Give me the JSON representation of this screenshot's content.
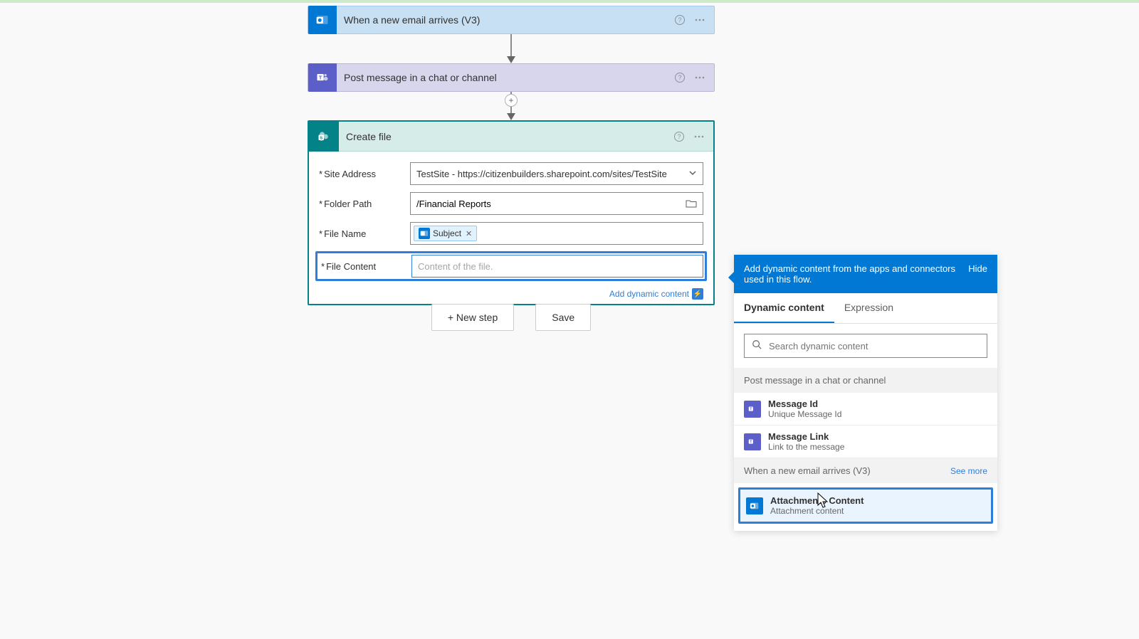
{
  "cards": {
    "trigger": {
      "title": "When a new email arrives (V3)"
    },
    "teams": {
      "title": "Post message in a chat or channel"
    },
    "createfile": {
      "title": "Create file"
    }
  },
  "form": {
    "siteAddress": {
      "label": "Site Address",
      "value": "TestSite - https://citizenbuilders.sharepoint.com/sites/TestSite"
    },
    "folderPath": {
      "label": "Folder Path",
      "value": "/Financial Reports"
    },
    "fileName": {
      "label": "File Name",
      "tokenLabel": "Subject"
    },
    "fileContent": {
      "label": "File Content",
      "placeholder": "Content of the file."
    }
  },
  "addDynamic": "Add dynamic content",
  "buttons": {
    "newStep": "+ New step",
    "save": "Save"
  },
  "dynPanel": {
    "heading": "Add dynamic content from the apps and connectors used in this flow.",
    "hide": "Hide",
    "tabs": {
      "dynamic": "Dynamic content",
      "expression": "Expression"
    },
    "searchPlaceholder": "Search dynamic content",
    "groups": {
      "teams": {
        "title": "Post message in a chat or channel",
        "items": [
          {
            "title": "Message Id",
            "desc": "Unique Message Id"
          },
          {
            "title": "Message Link",
            "desc": "Link to the message"
          }
        ]
      },
      "email": {
        "title": "When a new email arrives (V3)",
        "seeMore": "See more",
        "items": [
          {
            "title": "Attachments Content",
            "desc": "Attachment content"
          }
        ]
      }
    }
  }
}
